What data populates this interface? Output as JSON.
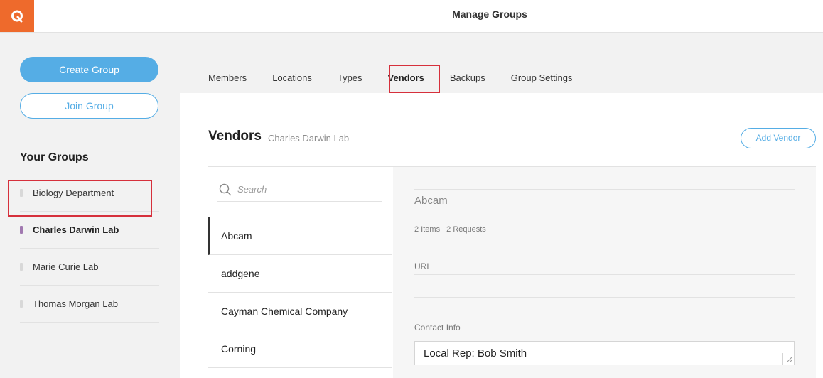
{
  "app": {
    "logo_icon": "quartzy-logo-icon",
    "title": "Manage Groups",
    "brand_color": "#ee6a2c",
    "accent_color": "#55ade5"
  },
  "sidebar": {
    "create_label": "Create Group",
    "join_label": "Join Group",
    "groups_heading": "Your Groups",
    "groups": [
      {
        "label": "Biology Department",
        "active": false
      },
      {
        "label": "Charles Darwin Lab",
        "active": true
      },
      {
        "label": "Marie Curie Lab",
        "active": false
      },
      {
        "label": "Thomas Morgan Lab",
        "active": false
      }
    ]
  },
  "tabs": [
    {
      "label": "Members",
      "active": false
    },
    {
      "label": "Locations",
      "active": false
    },
    {
      "label": "Types",
      "active": false
    },
    {
      "label": "Vendors",
      "active": true
    },
    {
      "label": "Backups",
      "active": false
    },
    {
      "label": "Group Settings",
      "active": false
    }
  ],
  "main": {
    "title": "Vendors",
    "subtitle": "Charles Darwin Lab",
    "add_vendor_label": "Add Vendor",
    "search": {
      "placeholder": "Search",
      "value": ""
    },
    "vendors": [
      {
        "label": "Abcam",
        "active": true
      },
      {
        "label": "addgene",
        "active": false
      },
      {
        "label": "Cayman Chemical Company",
        "active": false
      },
      {
        "label": "Corning",
        "active": false
      }
    ],
    "detail": {
      "name": "Abcam",
      "items_count": "2 Items",
      "requests_count": "2 Requests",
      "url_label": "URL",
      "url_value": "",
      "contact_label": "Contact Info",
      "contact_value": "Local Rep: Bob Smith"
    }
  },
  "highlight_color": "#d6303c"
}
